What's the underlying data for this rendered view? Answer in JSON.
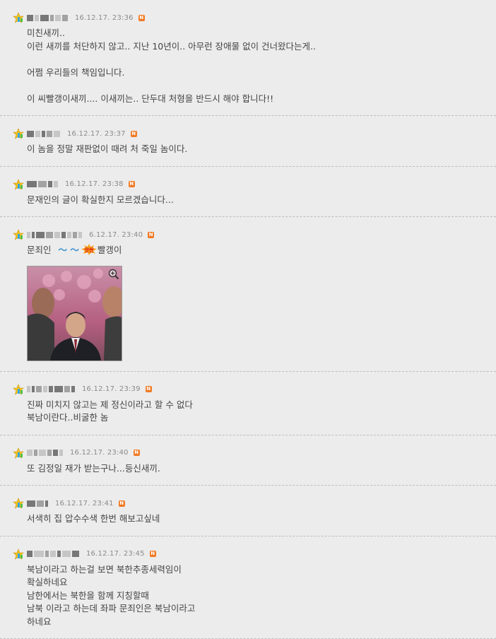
{
  "comments": [
    {
      "date": "16.12.17. 23:36",
      "badge": "N",
      "lines": [
        "미친새끼..",
        "이런 새끼를 처단하지 않고.. 지난 10년이.. 아무런 장애물 없이 건너왔다는게..",
        "",
        "어쩜 우리들의 책임입니다.",
        "",
        "이 씨빨갱이새끼.... 이새끼는.. 단두대 처형을 반드시 해야 합니다!!"
      ]
    },
    {
      "date": "16.12.17. 23:37",
      "badge": "N",
      "lines": [
        "이 놈을 정말 재판없이 때려 처 죽일 놈이다."
      ]
    },
    {
      "date": "16.12.17. 23:38",
      "badge": "N",
      "lines": [
        "문재인의 글이 확실한지 모르겠습니다..."
      ]
    },
    {
      "date": "6.12.17. 23:40",
      "badge": "N",
      "text_before": "문죄인",
      "emoticon_text": "～ ～",
      "emoticon_icon": "angry-burst-icon",
      "emoticon_label": "앗싼",
      "text_after": "빨갱이",
      "zoom_icon": "magnifier-plus-icon"
    },
    {
      "date": "16.12.17. 23:39",
      "badge": "N",
      "lines": [
        "진짜 미치지 않고는 제 정신이라고 할 수 없다",
        "북남이란다..비굴한 놈"
      ]
    },
    {
      "date": "16.12.17. 23:40",
      "badge": "N",
      "lines": [
        "또 김정일 재가 받는구나...등신새끼."
      ]
    },
    {
      "date": "16.12.17. 23:41",
      "badge": "N",
      "lines": [
        "서색히 집 압수수색 한번 해보고싶네"
      ]
    },
    {
      "date": "16.12.17. 23:45",
      "badge": "N",
      "lines": [
        "북남이라고 하는걸 보면 북한추종세력임이",
        "확실하네요",
        "남한에서는 북한을 함께 지칭할때",
        "남북 이라고 하는데 좌파 문죄인은 북남이라고",
        "하네요"
      ]
    }
  ],
  "colors": {
    "background": "#ececec",
    "badge": "#f07a24",
    "divider": "#bdbdbd",
    "emoticon": "#3a8fcf"
  },
  "icons": {
    "user_level": "star-level-icon",
    "new": "new-badge"
  }
}
